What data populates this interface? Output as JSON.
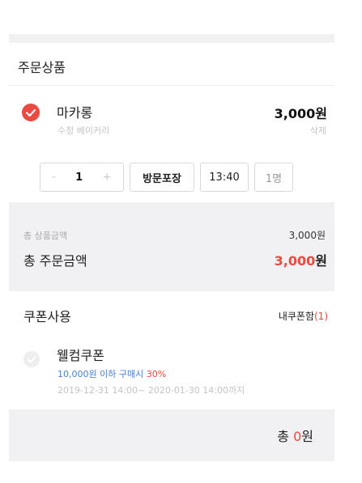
{
  "order": {
    "section_title": "주문상품",
    "item": {
      "name": "마카롱",
      "store": "수정 베이커리",
      "price": "3,000원",
      "delete_label": "삭제",
      "quantity": "1",
      "minus_label": "-",
      "plus_label": "+",
      "pickup_option": "방문포장",
      "time": "13:40",
      "people": "1명"
    }
  },
  "summary": {
    "product_total_label": "총 상품금액",
    "product_total_value": "3,000원",
    "order_total_label": "총 주문금액",
    "order_total_amount": "3,000",
    "order_total_unit": "원"
  },
  "coupon": {
    "section_title": "쿠폰사용",
    "my_coupons_label": "내쿠폰함",
    "my_coupons_count": "(1)",
    "item": {
      "name": "웰컴쿠폰",
      "condition_prefix": "10,000원 이하 구매시",
      "condition_discount": "30%",
      "period": "2019-12-31 14:00~ 2020-01-30 14:00까지"
    },
    "total_label": "총",
    "total_amount": "0",
    "total_unit": "원"
  },
  "colors": {
    "accent": "#ea4a40",
    "link_blue": "#4a7fd8",
    "band_gray": "#f1f1f3"
  }
}
